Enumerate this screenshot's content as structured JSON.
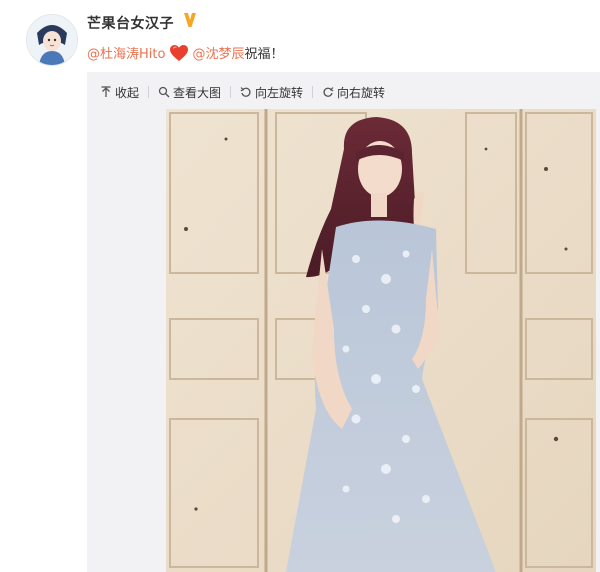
{
  "post": {
    "username": "芒果台女汉子",
    "mention1": "@杜海涛Hito",
    "mention2": "@沈梦辰",
    "text_suffix": " 祝福！"
  },
  "toolbar": {
    "collapse": "收起",
    "view_large": "查看大图",
    "rotate_left": "向左旋转",
    "rotate_right": "向右旋转"
  },
  "colors": {
    "mention": "#eb7350",
    "verify_badge": "#f5a623",
    "heart": "#e8402f",
    "media_bg": "#f2f2f5"
  },
  "icons": {
    "verify": "verified-badge-icon",
    "heart": "heart-emoji-icon",
    "collapse": "collapse-arrow-icon",
    "view_large": "magnifier-icon",
    "rotate_left": "rotate-left-icon",
    "rotate_right": "rotate-right-icon"
  }
}
